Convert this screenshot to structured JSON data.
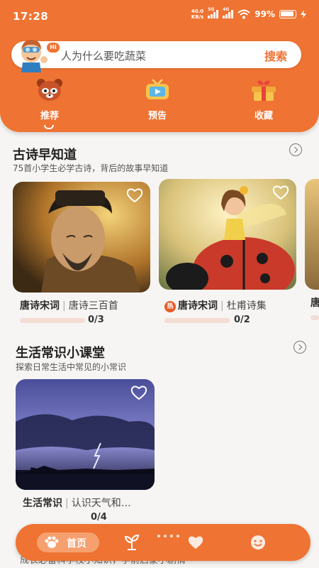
{
  "status_bar": {
    "time": "17:28",
    "net_speed_value": "40.0",
    "net_speed_unit": "KB/s",
    "signal_1": "5G",
    "signal_2": "4G",
    "battery": "99%"
  },
  "search": {
    "placeholder": "人为什么要吃蔬菜",
    "button_label": "搜索",
    "mascot_badge": "Hi"
  },
  "categories": [
    {
      "label": "推荐",
      "icon": "red-panda-icon"
    },
    {
      "label": "预告",
      "icon": "tv-icon"
    },
    {
      "label": "收藏",
      "icon": "gift-box-icon"
    }
  ],
  "sections": [
    {
      "title": "古诗早知道",
      "subtitle": "75首小学生必学古诗，背后的故事早知道",
      "cards": [
        {
          "category": "唐诗宋词",
          "subtitle": "唐诗三百首",
          "progress": "0/3",
          "hot": false
        },
        {
          "category": "唐诗宋词",
          "subtitle": "杜甫诗集",
          "progress": "0/2",
          "hot": true,
          "hot_label": "热"
        },
        {
          "category": "唐"
        }
      ]
    },
    {
      "title": "生活常识小课堂",
      "subtitle": "探索日常生活中常见的小常识",
      "cards": [
        {
          "category": "生活常识",
          "subtitle": "认识天气和…",
          "progress": "0/4"
        }
      ]
    }
  ],
  "footer_text": "成长必备科学校小知识，学前启蒙小剧情",
  "tabbar": {
    "home_label": "首页",
    "tabs": [
      "sprout-icon",
      "heart-icon",
      "smile-icon"
    ]
  },
  "colors": {
    "accent": "#ef7332",
    "background": "#f7f5f3"
  }
}
